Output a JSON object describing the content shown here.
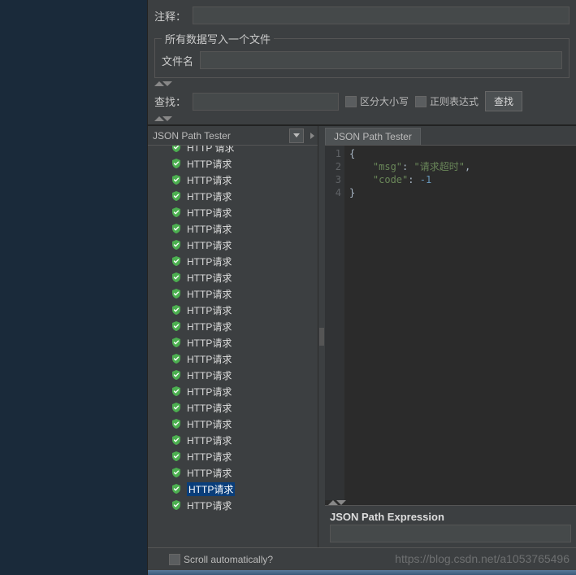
{
  "top": {
    "annotation_label": "注释：",
    "fieldset_title": "所有数据写入一个文件",
    "filename_label": "文件名"
  },
  "search": {
    "label": "查找：",
    "case_sensitive": "区分大小写",
    "regex": "正则表达式",
    "button": "查找"
  },
  "tree": {
    "header": "JSON Path Tester",
    "item_label": "HTTP请求",
    "partial_label": "HTTP 请求",
    "count": 22,
    "selected_index": 20
  },
  "code": {
    "tab": "JSON Path Tester",
    "lines": [
      {
        "n": 1,
        "raw": "{"
      },
      {
        "n": 2,
        "key": "msg",
        "str": "请求超时",
        "comma": true,
        "indent": true
      },
      {
        "n": 3,
        "key": "code",
        "num": "-1",
        "indent": true
      },
      {
        "n": 4,
        "raw": "}"
      }
    ]
  },
  "expression": {
    "label": "JSON Path Expression"
  },
  "footer": {
    "scroll_auto": "Scroll automatically?"
  },
  "watermark": "https://blog.csdn.net/a1053765496"
}
